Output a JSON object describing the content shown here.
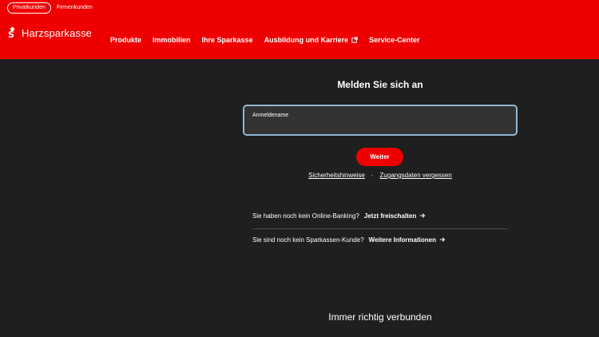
{
  "header": {
    "customer_tabs": [
      {
        "label": "Privatkunden",
        "active": true
      },
      {
        "label": "Firmenkunden",
        "active": false
      }
    ],
    "logo_text": "Harzsparkasse",
    "nav": [
      {
        "label": "Produkte"
      },
      {
        "label": "Immobilien"
      },
      {
        "label": "Ihre Sparkasse"
      },
      {
        "label": "Ausbildung und Karriere",
        "icon": "external-link-icon"
      },
      {
        "label": "Service-Center"
      }
    ],
    "brand_color": "#ee0000"
  },
  "login": {
    "title": "Melden Sie sich an",
    "username_label": "Anmeldename",
    "username_value": "",
    "submit_label": "Weiter",
    "links": {
      "security": "Sicherheitshinweise",
      "separator": "-",
      "forgot": "Zugangsdaten vergessen"
    }
  },
  "info": [
    {
      "text": "Sie haben noch kein Online-Banking?",
      "link": "Jetzt freischalten"
    },
    {
      "text": "Sie sind noch kein Sparkassen-Kunde?",
      "link": "Weitere Informationen"
    }
  ],
  "footer": {
    "title": "Immer richtig verbunden"
  }
}
